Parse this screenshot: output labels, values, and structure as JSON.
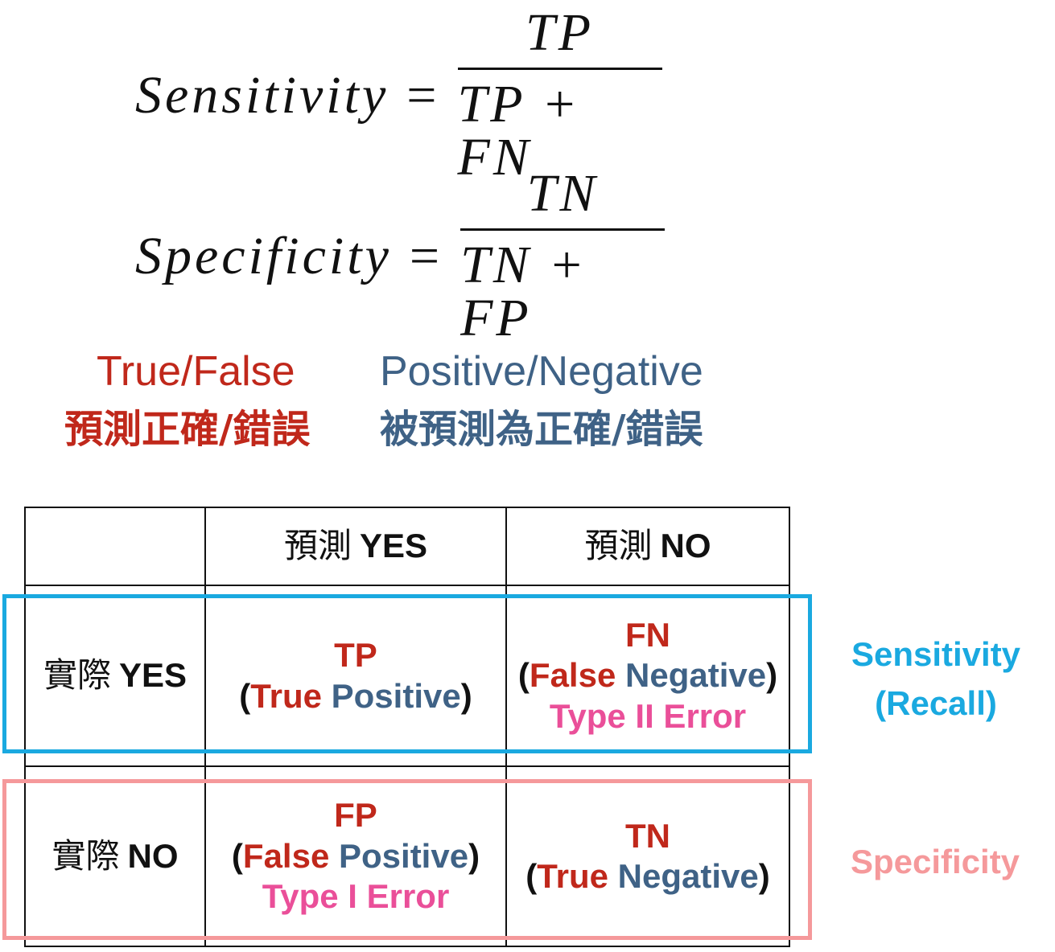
{
  "formulas": {
    "sensitivity": {
      "lhs": "Sensitivity",
      "eq": "=",
      "numerator": "TP",
      "denominator": "TP + FN"
    },
    "specificity": {
      "lhs": "Specificity",
      "eq": "=",
      "numerator": "TN",
      "denominator": "TN + FP"
    }
  },
  "legend": {
    "true_false": {
      "en": "True/False",
      "zh": "預測正確/錯誤"
    },
    "positive_negative": {
      "en": "Positive/Negative",
      "zh": "被預測為正確/錯誤"
    }
  },
  "table": {
    "col_headers": [
      {
        "zh": "預測",
        "en": "YES"
      },
      {
        "zh": "預測",
        "en": "NO"
      }
    ],
    "row_headers": [
      {
        "zh": "實際",
        "en": "YES"
      },
      {
        "zh": "實際",
        "en": "NO"
      }
    ],
    "cells": {
      "tp": {
        "abbr": "TP",
        "open": "(",
        "word1": "True",
        "word2": "Positive",
        "close": ")",
        "error": ""
      },
      "fn": {
        "abbr": "FN",
        "open": "(",
        "word1": "False",
        "word2": "Negative",
        "close": ")",
        "error": "Type II Error"
      },
      "fp": {
        "abbr": "FP",
        "open": "(",
        "word1": "False",
        "word2": "Positive",
        "close": ")",
        "error": "Type I Error"
      },
      "tn": {
        "abbr": "TN",
        "open": "(",
        "word1": "True",
        "word2": "Negative",
        "close": ")",
        "error": ""
      }
    }
  },
  "side_labels": {
    "sensitivity": {
      "line1": "Sensitivity",
      "line2": "(Recall)"
    },
    "specificity": {
      "line1": "Specificity"
    }
  },
  "colors": {
    "true_false": "#c0281b",
    "positive_negative": "#3f6286",
    "error": "#ea4f99",
    "sensitivity_box": "#1aa9e0",
    "specificity_box": "#f5999b"
  }
}
